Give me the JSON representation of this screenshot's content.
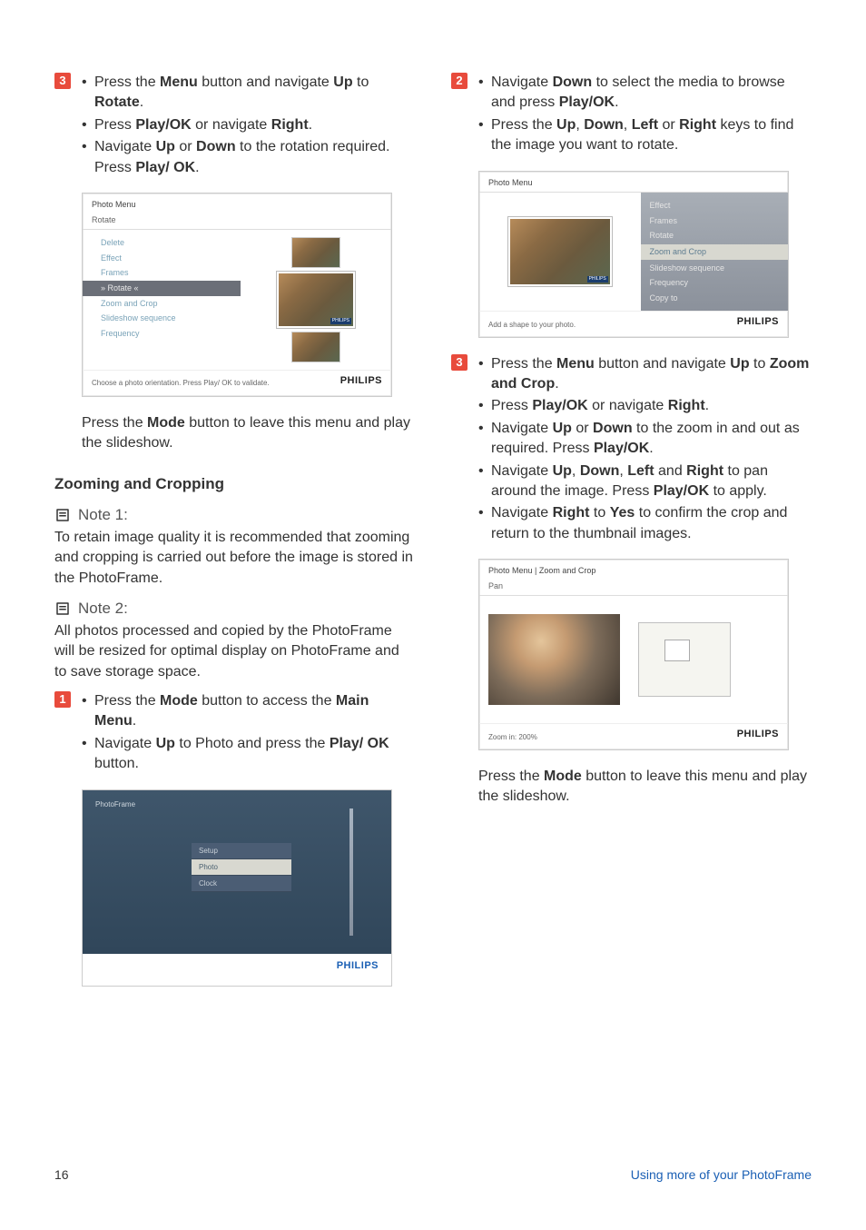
{
  "left": {
    "step3": {
      "num": "3",
      "b1_a": "Press the ",
      "b1_b": "Menu",
      "b1_c": " button and navigate ",
      "b1_d": "Up",
      "b1_e": " to ",
      "b1_f": "Rotate",
      "b1_g": ".",
      "b2_a": "Press ",
      "b2_b": "Play/OK",
      "b2_c": " or navigate ",
      "b2_d": "Right",
      "b2_e": ".",
      "b3_a": "Navigate ",
      "b3_b": "Up",
      "b3_c": " or ",
      "b3_d": "Down",
      "b3_e": " to the rotation required. Press ",
      "b3_f": "Play/ OK",
      "b3_g": "."
    },
    "sc1": {
      "header": "Photo Menu",
      "sub": "Rotate",
      "items": [
        "Delete",
        "Effect",
        "Frames",
        "» Rotate «",
        "Zoom and Crop",
        "Slideshow sequence",
        "Frequency"
      ],
      "footer": "Choose a photo orientation. Press Play/ OK to validate.",
      "brand": "PHILIPS",
      "thumb_tag": "PHILIPS"
    },
    "after_sc1_a": "Press the ",
    "after_sc1_b": "Mode",
    "after_sc1_c": " button to leave this menu and play the slideshow.",
    "heading_zoom": "Zooming and Cropping",
    "note1_title": "Note 1:",
    "note1_body": "To retain image quality it is recommended that zooming and cropping is carried out before the image is stored in the PhotoFrame.",
    "note2_title": "Note 2:",
    "note2_body": "All photos processed and copied by the PhotoFrame will be resized for optimal display on PhotoFrame and to save storage space.",
    "step1": {
      "num": "1",
      "b1_a": "Press the ",
      "b1_b": "Mode",
      "b1_c": " button to access the ",
      "b1_d": "Main Menu",
      "b1_e": ".",
      "b2_a": "Navigate ",
      "b2_b": "Up",
      "b2_c": " to Photo and press the ",
      "b2_d": "Play/ OK",
      "b2_e": " button."
    },
    "sc3": {
      "title": "PhotoFrame",
      "items": [
        "Setup",
        "Photo",
        "Clock"
      ],
      "brand": "PHILIPS"
    }
  },
  "right": {
    "step2": {
      "num": "2",
      "b1_a": "Navigate ",
      "b1_b": "Down",
      "b1_c": " to select the media to browse and press ",
      "b1_d": "Play/OK",
      "b1_e": ".",
      "b2_a": "Press the ",
      "b2_b": "Up",
      "b2_c": ", ",
      "b2_d": "Down",
      "b2_e": ", ",
      "b2_f": "Left",
      "b2_g": " or ",
      "b2_h": "Right",
      "b2_i": " keys to find the image you want to rotate."
    },
    "sc2": {
      "header": "Photo Menu",
      "items": [
        "Effect",
        "Frames",
        "Rotate",
        "Zoom and Crop",
        "Slideshow sequence",
        "Frequency",
        "Copy to"
      ],
      "footer": "Add a shape to your photo.",
      "brand": "PHILIPS",
      "thumb_tag": "PHILIPS"
    },
    "step3": {
      "num": "3",
      "b1_a": "Press the ",
      "b1_b": "Menu",
      "b1_c": " button and navigate ",
      "b1_d": "Up",
      "b1_e": " to ",
      "b1_f": "Zoom and Crop",
      "b1_g": ".",
      "b2_a": "Press ",
      "b2_b": "Play/OK",
      "b2_c": " or navigate ",
      "b2_d": "Right",
      "b2_e": ".",
      "b3_a": "Navigate ",
      "b3_b": "Up",
      "b3_c": " or ",
      "b3_d": "Down",
      "b3_e": " to the zoom in and out as required. Press ",
      "b3_f": "Play/OK",
      "b3_g": ".",
      "b4_a": "Navigate ",
      "b4_b": "Up",
      "b4_c": ", ",
      "b4_d": "Down",
      "b4_e": ", ",
      "b4_f": "Left",
      "b4_g": " and ",
      "b4_h": "Right",
      "b4_i": " to pan around the image. Press ",
      "b4_j": "Play/OK",
      "b4_k": " to apply.",
      "b5_a": "Navigate ",
      "b5_b": "Right",
      "b5_c": " to ",
      "b5_d": "Yes",
      "b5_e": " to confirm the crop and return to the thumbnail images."
    },
    "sc4": {
      "header": "Photo Menu | Zoom and Crop",
      "sub": "Pan",
      "footer": "Zoom in: 200%",
      "brand": "PHILIPS"
    },
    "after_sc4_a": "Press the ",
    "after_sc4_b": "Mode",
    "after_sc4_c": " button to leave this menu and play the slideshow."
  },
  "footer": {
    "page": "16",
    "section": "Using more of your PhotoFrame"
  }
}
